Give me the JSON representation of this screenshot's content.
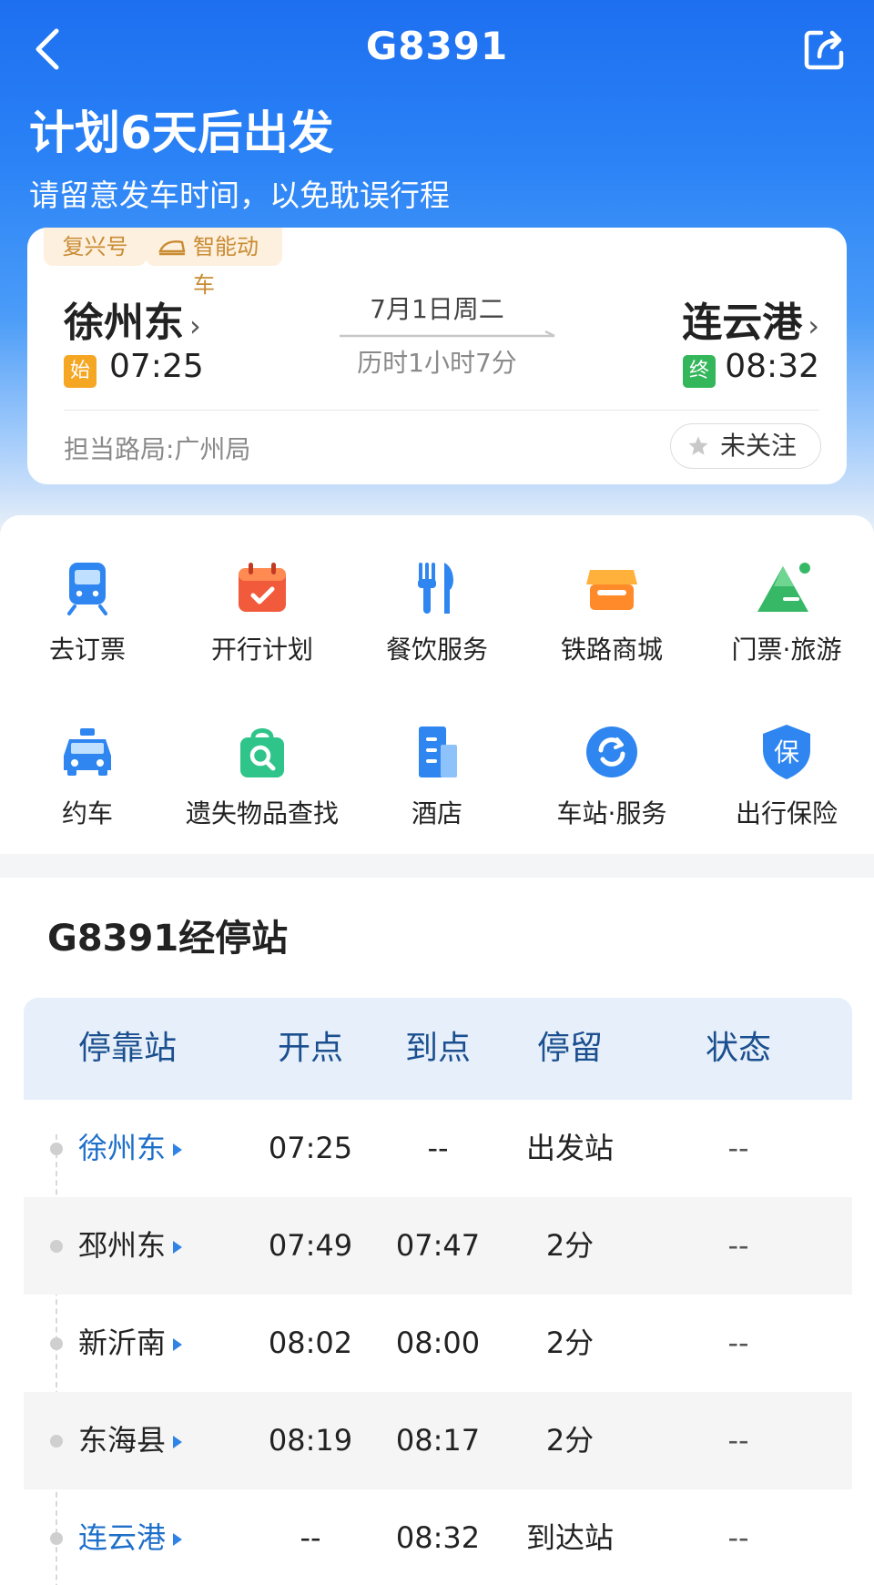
{
  "header": {
    "title": "G8391",
    "headline": "计划6天后出发",
    "subline": "请留意发车时间，以免耽误行程"
  },
  "card": {
    "tag_fuxing": "复兴号",
    "tag_smart": "智能动车",
    "from_station": "徐州东",
    "to_station": "连云港",
    "chevron": "›",
    "start_badge": "始",
    "end_badge": "终",
    "dep_time": "07:25",
    "arr_time": "08:32",
    "date": "7月1日周二",
    "duration": "历时1小时7分",
    "bureau": "担当路局:广州局",
    "follow_label": "未关注"
  },
  "services": [
    {
      "label": "去订票",
      "icon": "train-icon"
    },
    {
      "label": "开行计划",
      "icon": "calendar-check-icon"
    },
    {
      "label": "餐饮服务",
      "icon": "fork-knife-icon"
    },
    {
      "label": "铁路商城",
      "icon": "shop-icon"
    },
    {
      "label": "门票·旅游",
      "icon": "mountain-icon"
    },
    {
      "label": "约车",
      "icon": "taxi-icon"
    },
    {
      "label": "遗失物品查找",
      "icon": "lost-bag-search-icon"
    },
    {
      "label": "酒店",
      "icon": "hotel-icon"
    },
    {
      "label": "车站·服务",
      "icon": "station-service-icon"
    },
    {
      "label": "出行保险",
      "icon": "insurance-shield-icon"
    }
  ],
  "stops": {
    "title": "G8391经停站",
    "columns": [
      "停靠站",
      "开点",
      "到点",
      "停留",
      "状态"
    ],
    "rows": [
      {
        "station": "徐州东",
        "depart": "07:25",
        "arrive": "--",
        "stay": "出发站",
        "status": "--"
      },
      {
        "station": "邳州东",
        "depart": "07:49",
        "arrive": "07:47",
        "stay": "2分",
        "status": "--"
      },
      {
        "station": "新沂南",
        "depart": "08:02",
        "arrive": "08:00",
        "stay": "2分",
        "status": "--"
      },
      {
        "station": "东海县",
        "depart": "08:19",
        "arrive": "08:17",
        "stay": "2分",
        "status": "--"
      },
      {
        "station": "连云港",
        "depart": "--",
        "arrive": "08:32",
        "stay": "到达站",
        "status": "--"
      }
    ]
  },
  "colors": {
    "brand_blue": "#1d6ff0",
    "station_link": "#1e6fca",
    "start_badge": "#f5a623",
    "end_badge": "#34b65a",
    "tag_text": "#c98b33"
  }
}
